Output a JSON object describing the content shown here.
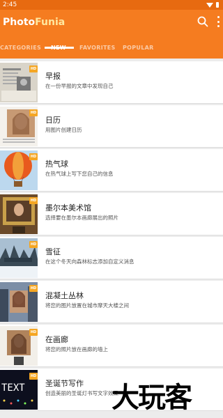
{
  "status_bar": {
    "time": "2:45"
  },
  "app_bar": {
    "logo_part1": "Photo",
    "logo_part2": "Funia",
    "accent_color": "#f57c20",
    "tabs": [
      {
        "label": "CATEGORIES",
        "active": false
      },
      {
        "label": "NEW",
        "active": true
      },
      {
        "label": "FAVORITES",
        "active": false
      },
      {
        "label": "POPULAR",
        "active": false
      }
    ]
  },
  "effects": [
    {
      "title": "早报",
      "description": "在一份早报的文章中发现自己",
      "badge": "HD",
      "thumb": "newspaper"
    },
    {
      "title": "日历",
      "description": "用图片创建日历",
      "badge": "HD",
      "thumb": "calendar"
    },
    {
      "title": "热气球",
      "description": "在热气球上写下您自己的信息",
      "badge": "HD",
      "thumb": "balloon"
    },
    {
      "title": "墨尔本美术馆",
      "description": "选择要在墨尔本画廊展出的照片",
      "badge": "HD",
      "thumb": "frame"
    },
    {
      "title": "雪征",
      "description": "在这个冬天向森林标志添加自定义消息",
      "badge": "HD",
      "thumb": "snow"
    },
    {
      "title": "混凝土丛林",
      "description": "将您的图片放置在城市摩天大楼之间",
      "badge": "HD",
      "thumb": "city"
    },
    {
      "title": "在画廊",
      "description": "将您的照片放在画廊的墙上",
      "badge": "HD",
      "thumb": "gallery"
    },
    {
      "title": "圣诞节写作",
      "description": "创造美丽的圣诞灯书写文字效果",
      "badge": "HD",
      "thumb": "text"
    }
  ],
  "thumb_text_label": "TEXT",
  "watermark": "大玩客"
}
